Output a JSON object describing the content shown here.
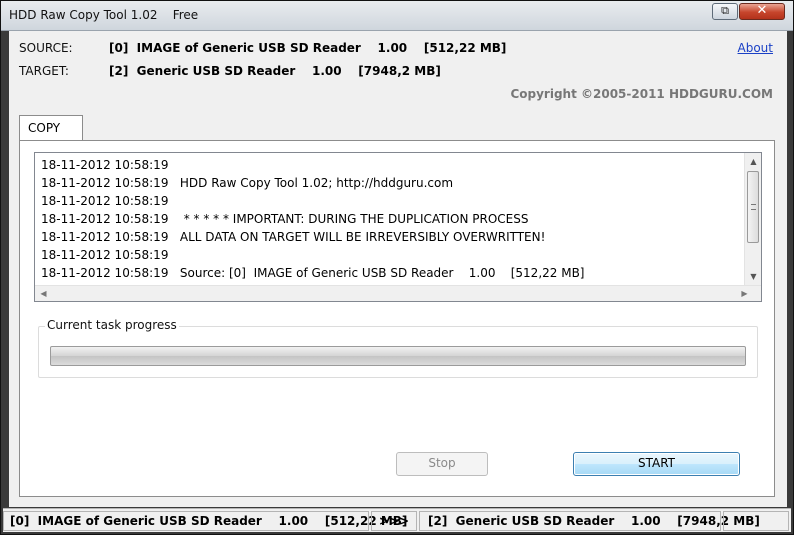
{
  "window": {
    "title": "HDD Raw Copy Tool 1.02    Free",
    "restore_glyph": "⧉",
    "close_glyph": "✕"
  },
  "header": {
    "source_label": "SOURCE:",
    "source_value": "[0]  IMAGE of Generic USB SD Reader    1.00    [512,22 MB]",
    "target_label": "TARGET:",
    "target_value": "[2]  Generic USB SD Reader    1.00    [7948,2 MB]",
    "about_link": "About",
    "copyright": "Copyright ©2005-2011 HDDGURU.COM"
  },
  "tabs": [
    {
      "label": "COPY"
    }
  ],
  "log": {
    "lines": [
      "18-11-2012 10:58:19",
      "18-11-2012 10:58:19   HDD Raw Copy Tool 1.02; http://hddguru.com",
      "18-11-2012 10:58:19",
      "18-11-2012 10:58:19    * * * * * IMPORTANT: DURING THE DUPLICATION PROCESS",
      "18-11-2012 10:58:19   ALL DATA ON TARGET WILL BE IRREVERSIBLY OVERWRITTEN!",
      "18-11-2012 10:58:19",
      "18-11-2012 10:58:19   Source: [0]  IMAGE of Generic USB SD Reader    1.00    [512,22 MB]"
    ],
    "scroll_up_glyph": "▲",
    "scroll_down_glyph": "▼",
    "scroll_left_glyph": "◀",
    "scroll_right_glyph": "▶"
  },
  "progress": {
    "group_title": "Current task progress",
    "fraction": 0
  },
  "buttons": {
    "stop_label": "Stop",
    "start_label": "START"
  },
  "statusbar": {
    "source": "[0]  IMAGE of Generic USB SD Reader    1.00    [512,22 MB]",
    "arrow": ">>>",
    "target": "[2]  Generic USB SD Reader    1.00    [7948,2 MB]"
  }
}
